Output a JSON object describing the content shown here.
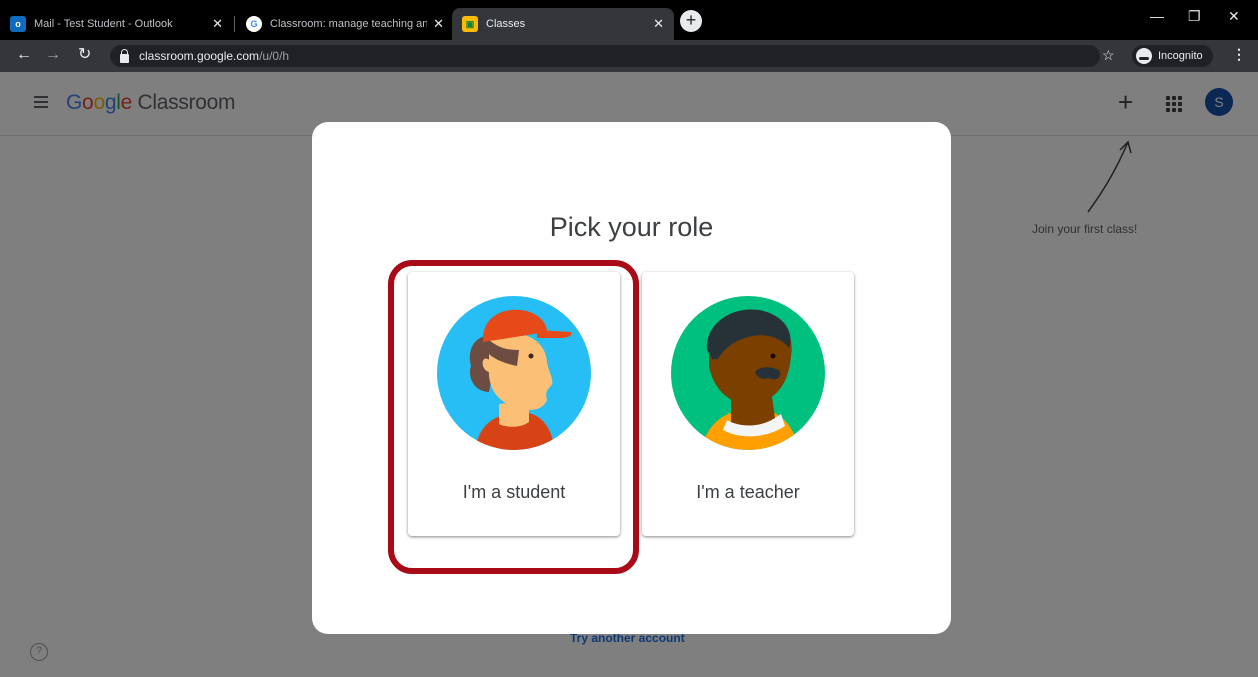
{
  "browser": {
    "tabs": [
      {
        "title": "Mail - Test Student - Outlook",
        "favicon": "outlook-icon",
        "active": false
      },
      {
        "title": "Classroom: manage teaching and",
        "favicon": "google-icon",
        "active": false
      },
      {
        "title": "Classes",
        "favicon": "classroom-icon",
        "active": true
      }
    ],
    "url_host": "classroom.google.com",
    "url_path": "/u/0/h",
    "incognito_label": "Incognito"
  },
  "app": {
    "logo_google": [
      "G",
      "o",
      "o",
      "g",
      "l",
      "e"
    ],
    "logo_product": "Classroom",
    "avatar_letter": "S",
    "join_hint": "Join your first class!",
    "try_account": "Try another account"
  },
  "modal": {
    "title": "Pick your role",
    "roles": [
      {
        "label": "I'm a student",
        "highlighted": true
      },
      {
        "label": "I'm a teacher",
        "highlighted": false
      }
    ]
  },
  "colors": {
    "highlight": "#a80b17",
    "avatar": "#174ea6",
    "student_bg": "#27bdf5",
    "teacher_bg": "#00c07f"
  }
}
